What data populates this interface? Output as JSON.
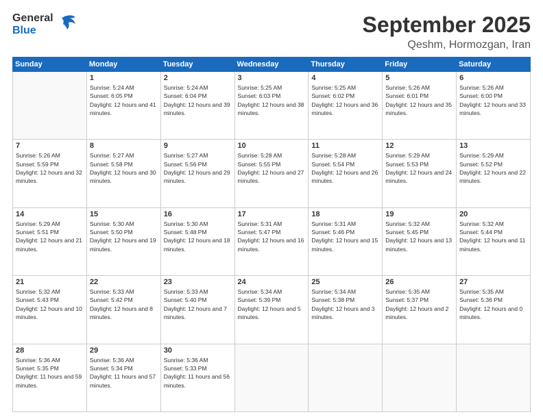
{
  "header": {
    "logo": {
      "general": "General",
      "blue": "Blue"
    },
    "month": "September 2025",
    "location": "Qeshm, Hormozgan, Iran"
  },
  "weekdays": [
    "Sunday",
    "Monday",
    "Tuesday",
    "Wednesday",
    "Thursday",
    "Friday",
    "Saturday"
  ],
  "weeks": [
    [
      {
        "day": null
      },
      {
        "day": 1,
        "sunrise": "5:24 AM",
        "sunset": "6:05 PM",
        "daylight": "12 hours and 41 minutes."
      },
      {
        "day": 2,
        "sunrise": "5:24 AM",
        "sunset": "6:04 PM",
        "daylight": "12 hours and 39 minutes."
      },
      {
        "day": 3,
        "sunrise": "5:25 AM",
        "sunset": "6:03 PM",
        "daylight": "12 hours and 38 minutes."
      },
      {
        "day": 4,
        "sunrise": "5:25 AM",
        "sunset": "6:02 PM",
        "daylight": "12 hours and 36 minutes."
      },
      {
        "day": 5,
        "sunrise": "5:26 AM",
        "sunset": "6:01 PM",
        "daylight": "12 hours and 35 minutes."
      },
      {
        "day": 6,
        "sunrise": "5:26 AM",
        "sunset": "6:00 PM",
        "daylight": "12 hours and 33 minutes."
      }
    ],
    [
      {
        "day": 7,
        "sunrise": "5:26 AM",
        "sunset": "5:59 PM",
        "daylight": "12 hours and 32 minutes."
      },
      {
        "day": 8,
        "sunrise": "5:27 AM",
        "sunset": "5:58 PM",
        "daylight": "12 hours and 30 minutes."
      },
      {
        "day": 9,
        "sunrise": "5:27 AM",
        "sunset": "5:56 PM",
        "daylight": "12 hours and 29 minutes."
      },
      {
        "day": 10,
        "sunrise": "5:28 AM",
        "sunset": "5:55 PM",
        "daylight": "12 hours and 27 minutes."
      },
      {
        "day": 11,
        "sunrise": "5:28 AM",
        "sunset": "5:54 PM",
        "daylight": "12 hours and 26 minutes."
      },
      {
        "day": 12,
        "sunrise": "5:29 AM",
        "sunset": "5:53 PM",
        "daylight": "12 hours and 24 minutes."
      },
      {
        "day": 13,
        "sunrise": "5:29 AM",
        "sunset": "5:52 PM",
        "daylight": "12 hours and 22 minutes."
      }
    ],
    [
      {
        "day": 14,
        "sunrise": "5:29 AM",
        "sunset": "5:51 PM",
        "daylight": "12 hours and 21 minutes."
      },
      {
        "day": 15,
        "sunrise": "5:30 AM",
        "sunset": "5:50 PM",
        "daylight": "12 hours and 19 minutes."
      },
      {
        "day": 16,
        "sunrise": "5:30 AM",
        "sunset": "5:48 PM",
        "daylight": "12 hours and 18 minutes."
      },
      {
        "day": 17,
        "sunrise": "5:31 AM",
        "sunset": "5:47 PM",
        "daylight": "12 hours and 16 minutes."
      },
      {
        "day": 18,
        "sunrise": "5:31 AM",
        "sunset": "5:46 PM",
        "daylight": "12 hours and 15 minutes."
      },
      {
        "day": 19,
        "sunrise": "5:32 AM",
        "sunset": "5:45 PM",
        "daylight": "12 hours and 13 minutes."
      },
      {
        "day": 20,
        "sunrise": "5:32 AM",
        "sunset": "5:44 PM",
        "daylight": "12 hours and 11 minutes."
      }
    ],
    [
      {
        "day": 21,
        "sunrise": "5:32 AM",
        "sunset": "5:43 PM",
        "daylight": "12 hours and 10 minutes."
      },
      {
        "day": 22,
        "sunrise": "5:33 AM",
        "sunset": "5:42 PM",
        "daylight": "12 hours and 8 minutes."
      },
      {
        "day": 23,
        "sunrise": "5:33 AM",
        "sunset": "5:40 PM",
        "daylight": "12 hours and 7 minutes."
      },
      {
        "day": 24,
        "sunrise": "5:34 AM",
        "sunset": "5:39 PM",
        "daylight": "12 hours and 5 minutes."
      },
      {
        "day": 25,
        "sunrise": "5:34 AM",
        "sunset": "5:38 PM",
        "daylight": "12 hours and 3 minutes."
      },
      {
        "day": 26,
        "sunrise": "5:35 AM",
        "sunset": "5:37 PM",
        "daylight": "12 hours and 2 minutes."
      },
      {
        "day": 27,
        "sunrise": "5:35 AM",
        "sunset": "5:36 PM",
        "daylight": "12 hours and 0 minutes."
      }
    ],
    [
      {
        "day": 28,
        "sunrise": "5:36 AM",
        "sunset": "5:35 PM",
        "daylight": "11 hours and 59 minutes."
      },
      {
        "day": 29,
        "sunrise": "5:36 AM",
        "sunset": "5:34 PM",
        "daylight": "11 hours and 57 minutes."
      },
      {
        "day": 30,
        "sunrise": "5:36 AM",
        "sunset": "5:33 PM",
        "daylight": "11 hours and 56 minutes."
      },
      {
        "day": null
      },
      {
        "day": null
      },
      {
        "day": null
      },
      {
        "day": null
      }
    ]
  ],
  "labels": {
    "sunrise": "Sunrise:",
    "sunset": "Sunset:",
    "daylight": "Daylight:"
  }
}
